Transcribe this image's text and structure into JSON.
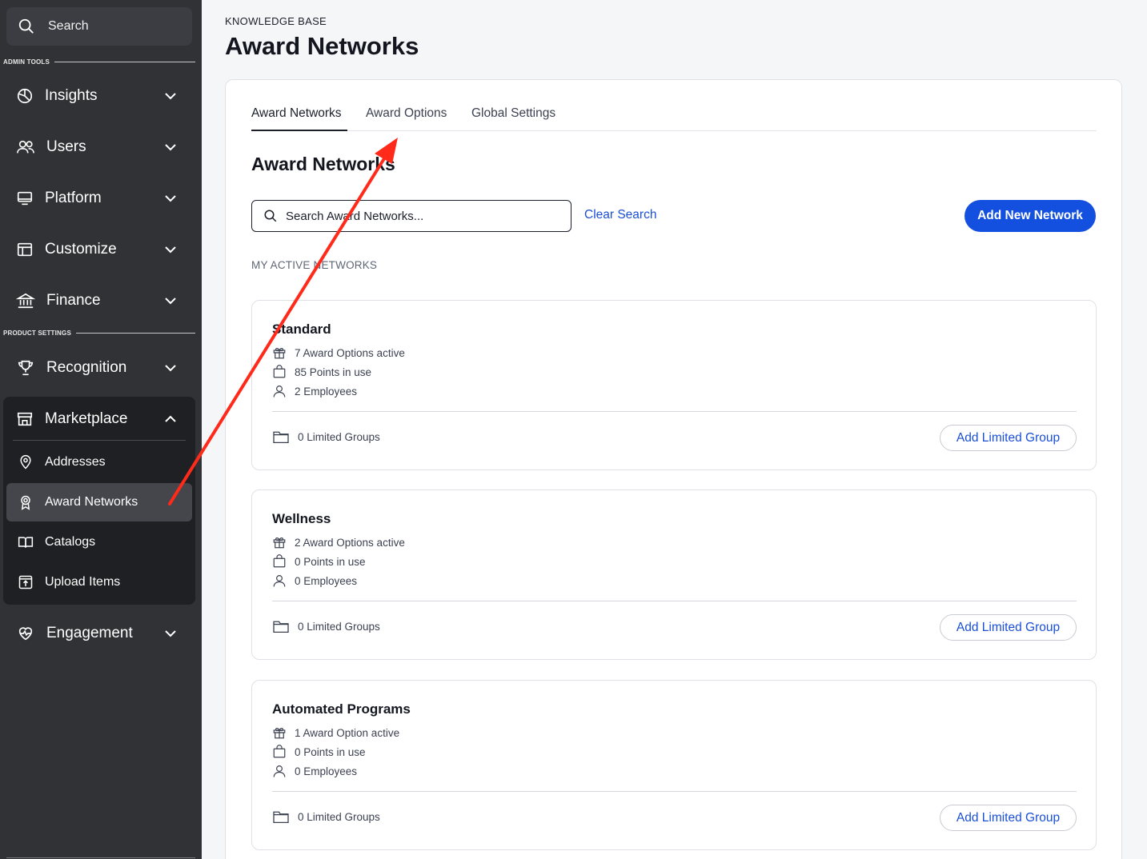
{
  "sidebar": {
    "search_label": "Search",
    "section_admin": "ADMIN TOOLS",
    "section_product": "PRODUCT SETTINGS",
    "items": [
      {
        "label": "Insights"
      },
      {
        "label": "Users"
      },
      {
        "label": "Platform"
      },
      {
        "label": "Customize"
      },
      {
        "label": "Finance"
      },
      {
        "label": "Recognition"
      },
      {
        "label": "Marketplace"
      },
      {
        "label": "Engagement"
      }
    ],
    "marketplace_sub": [
      {
        "label": "Addresses"
      },
      {
        "label": "Award Networks"
      },
      {
        "label": "Catalogs"
      },
      {
        "label": "Upload Items"
      }
    ]
  },
  "header": {
    "breadcrumb": "KNOWLEDGE BASE",
    "title": "Award Networks"
  },
  "tabs": [
    {
      "label": "Award Networks"
    },
    {
      "label": "Award Options"
    },
    {
      "label": "Global Settings"
    }
  ],
  "main": {
    "section_title": "Award Networks",
    "search_placeholder": "Search Award Networks...",
    "clear_search": "Clear Search",
    "add_network": "Add New Network",
    "active_label": "MY ACTIVE NETWORKS"
  },
  "networks": [
    {
      "name": "Standard",
      "options": "7 Award Options active",
      "points": "85 Points in use",
      "employees": "2 Employees",
      "groups": "0 Limited Groups",
      "add_group": "Add Limited Group"
    },
    {
      "name": "Wellness",
      "options": "2 Award Options active",
      "points": "0 Points in use",
      "employees": "0 Employees",
      "groups": "0 Limited Groups",
      "add_group": "Add Limited Group"
    },
    {
      "name": "Automated Programs",
      "options": "1 Award Option active",
      "points": "0 Points in use",
      "employees": "0 Employees",
      "groups": "0 Limited Groups",
      "add_group": "Add Limited Group"
    }
  ],
  "colors": {
    "sidebar_bg": "#313236",
    "accent": "#1450e0",
    "link": "#1a4fd6",
    "annotation_arrow": "#ff2a1a"
  }
}
